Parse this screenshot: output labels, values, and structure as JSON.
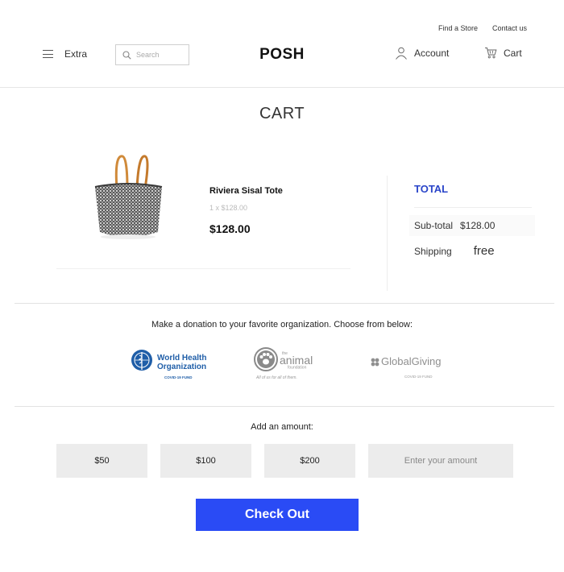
{
  "top_links": {
    "find_store": "Find a Store",
    "contact": "Contact us"
  },
  "header": {
    "menu_label": "Extra",
    "search_placeholder": "Search",
    "logo": "POSH",
    "account_label": "Account",
    "cart_label": "Cart"
  },
  "page_title": "CART",
  "cart_item": {
    "name": "Riviera Sisal Tote",
    "quantity_line": "1 x $128.00",
    "price": "$128.00"
  },
  "totals": {
    "title": "TOTAL",
    "subtotal_label": "Sub-total",
    "subtotal_value": "$128.00",
    "shipping_label": "Shipping",
    "shipping_value": "free"
  },
  "donation": {
    "prompt": "Make a donation to your favorite organization. Choose from below:",
    "organizations": [
      {
        "name_line1": "World Health",
        "name_line2": "Organization",
        "sub": "COVID-19 FUND"
      },
      {
        "name_pre": "the",
        "name": "animal",
        "name_post": "foundation",
        "tagline": "All of us for all of them."
      },
      {
        "name": "GlobalGiving",
        "sub": "COVID-19 FUND"
      }
    ],
    "amount_label": "Add an amount:",
    "amounts": [
      "$50",
      "$100",
      "$200"
    ],
    "custom_placeholder": "Enter your amount"
  },
  "checkout_label": "Check Out",
  "colors": {
    "accent_blue": "#2a4bf5",
    "total_blue": "#2a45c9",
    "who_blue": "#1f5ea8"
  }
}
